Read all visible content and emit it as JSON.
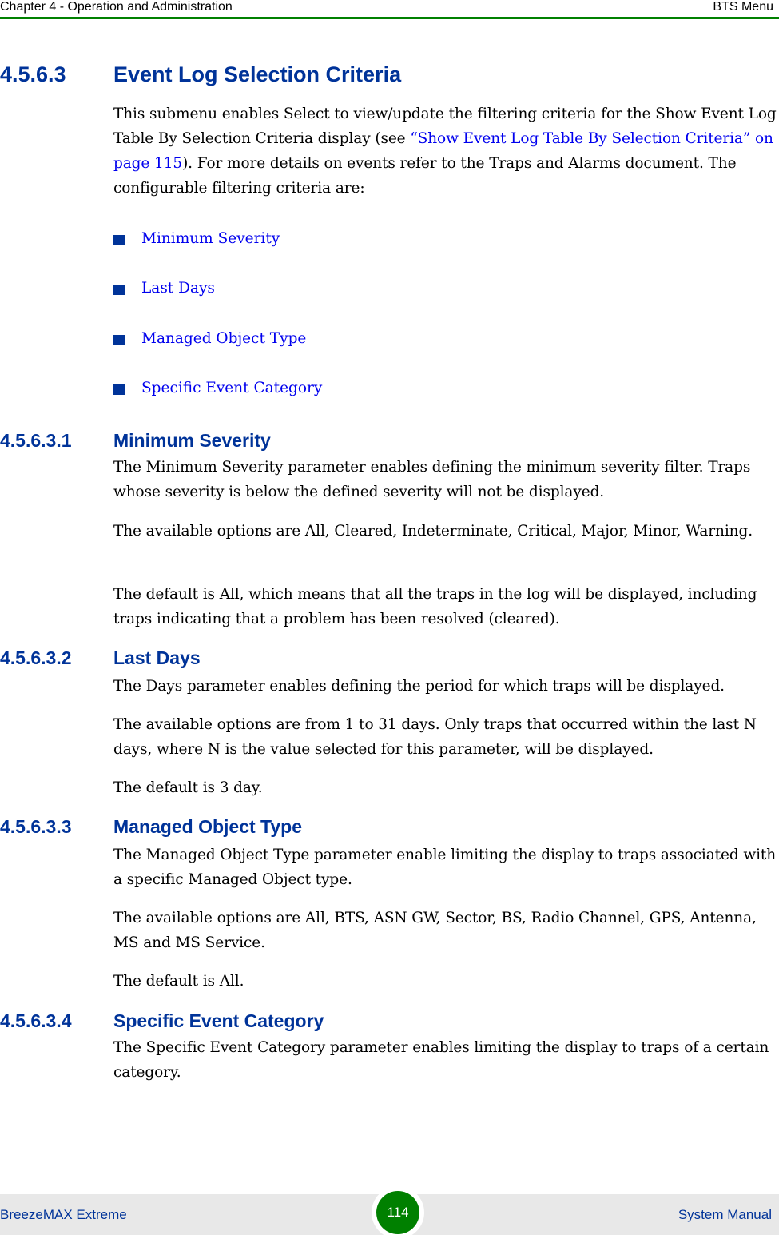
{
  "header": {
    "chapter": "Chapter 4 - Operation and Administration",
    "section": "BTS Menu"
  },
  "section": {
    "number": "4.5.6.3",
    "title": "Event Log Selection Criteria",
    "intro_before_link": "This submenu enables Select to view/update the filtering criteria for the Show Event Log Table By Selection Criteria display (see ",
    "intro_link": "“Show Event Log Table By Selection Criteria” on page 115",
    "intro_after_link": "). For more details on events refer to the Traps and Alarms document. The configurable filtering criteria are:",
    "bullets": [
      "Minimum Severity",
      "Last Days",
      "Managed Object Type",
      "Specific Event Category"
    ]
  },
  "subsections": [
    {
      "number": "4.5.6.3.1",
      "title": "Minimum Severity",
      "paragraphs": [
        "The Minimum Severity parameter enables defining the minimum severity filter. Traps whose severity is below the defined severity will not be displayed.",
        "The available options are All, Cleared, Indeterminate, Critical, Major, Minor, Warning.",
        "The default is All, which means that all the traps in the log will be displayed, including traps indicating that a problem has been resolved (cleared)."
      ]
    },
    {
      "number": "4.5.6.3.2",
      "title": "Last Days",
      "paragraphs": [
        "The Days parameter enables defining the period for which traps will be displayed.",
        "The available options are from 1 to 31 days. Only traps that occurred within the last N days, where N is the value selected for this parameter, will be displayed.",
        "The default is 3 day."
      ]
    },
    {
      "number": "4.5.6.3.3",
      "title": "Managed Object Type",
      "paragraphs": [
        "The Managed Object Type parameter enable limiting the display to traps associated with a specific Managed Object type.",
        "The available options are All, BTS, ASN GW, Sector, BS, Radio Channel, GPS, Antenna, MS and MS Service.",
        "The default is All."
      ]
    },
    {
      "number": "4.5.6.3.4",
      "title": "Specific Event Category",
      "paragraphs": [
        "The Specific Event Category parameter enables limiting the display to traps of a certain category."
      ]
    }
  ],
  "footer": {
    "product": "BreezeMAX Extreme",
    "page_number": "114",
    "doc_type": "System Manual"
  }
}
